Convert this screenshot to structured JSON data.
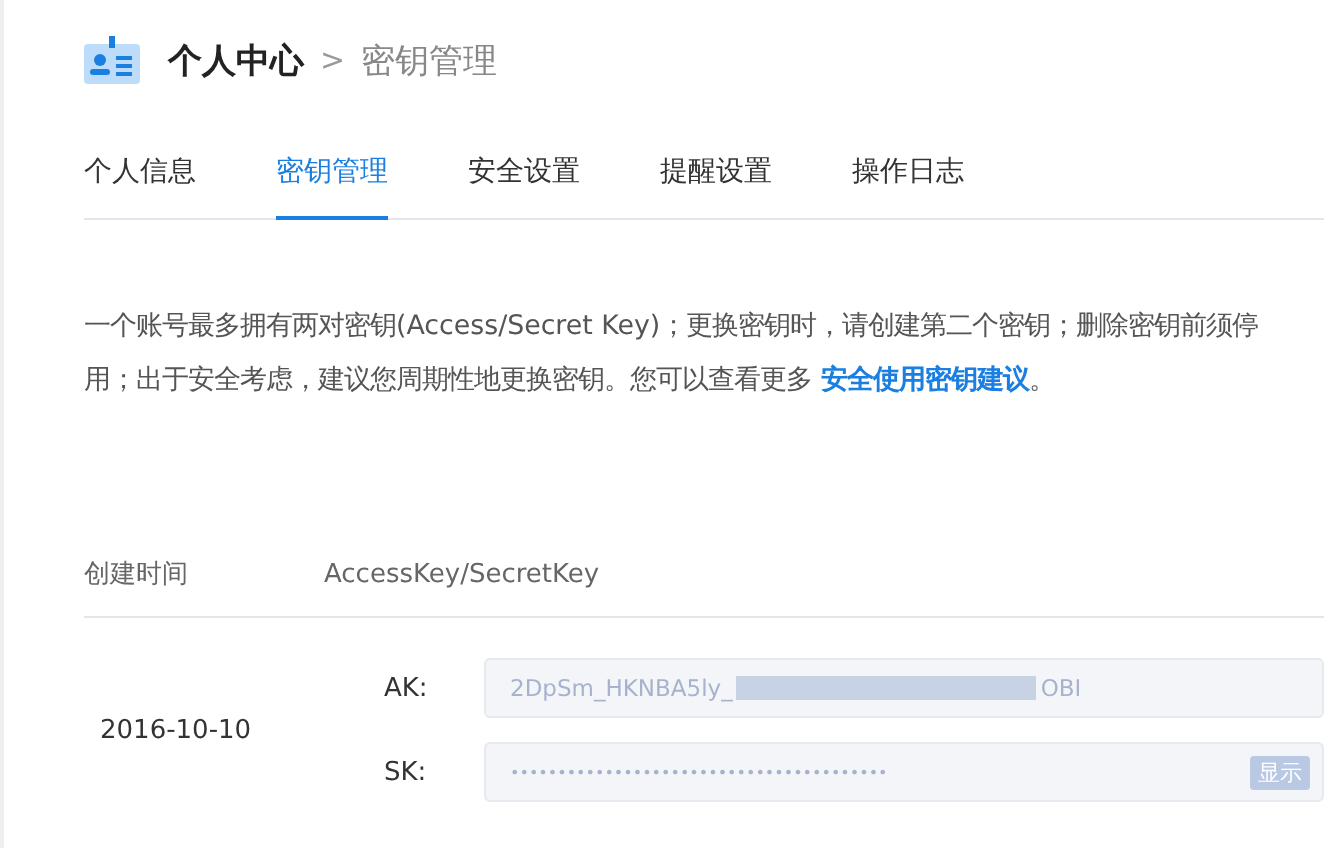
{
  "header": {
    "title": "个人中心",
    "separator": ">",
    "current": "密钥管理"
  },
  "tabs": [
    {
      "label": "个人信息",
      "selected": false
    },
    {
      "label": "密钥管理",
      "selected": true
    },
    {
      "label": "安全设置",
      "selected": false
    },
    {
      "label": "提醒设置",
      "selected": false
    },
    {
      "label": "操作日志",
      "selected": false
    }
  ],
  "notice": {
    "text": "一个账号最多拥有两对密钥(Access/Secret Key)；更换密钥时，请创建第二个密钥；删除密钥前须停用；出于安全考虑，建议您周期性地更换密钥。您可以查看更多 ",
    "link": "安全使用密钥建议",
    "end": "。"
  },
  "table": {
    "columns": [
      "创建时间",
      "AccessKey/SecretKey"
    ],
    "rows": [
      {
        "created": "2016-10-10",
        "ak_label": "AK:",
        "ak_value_start": "2DpSm_HKNBA5ly_",
        "ak_value_end": "OBI",
        "sk_label": "SK:",
        "sk_value": "••••••••••••••••••••••••••••••••••••••••",
        "show_button": "显示"
      }
    ]
  }
}
